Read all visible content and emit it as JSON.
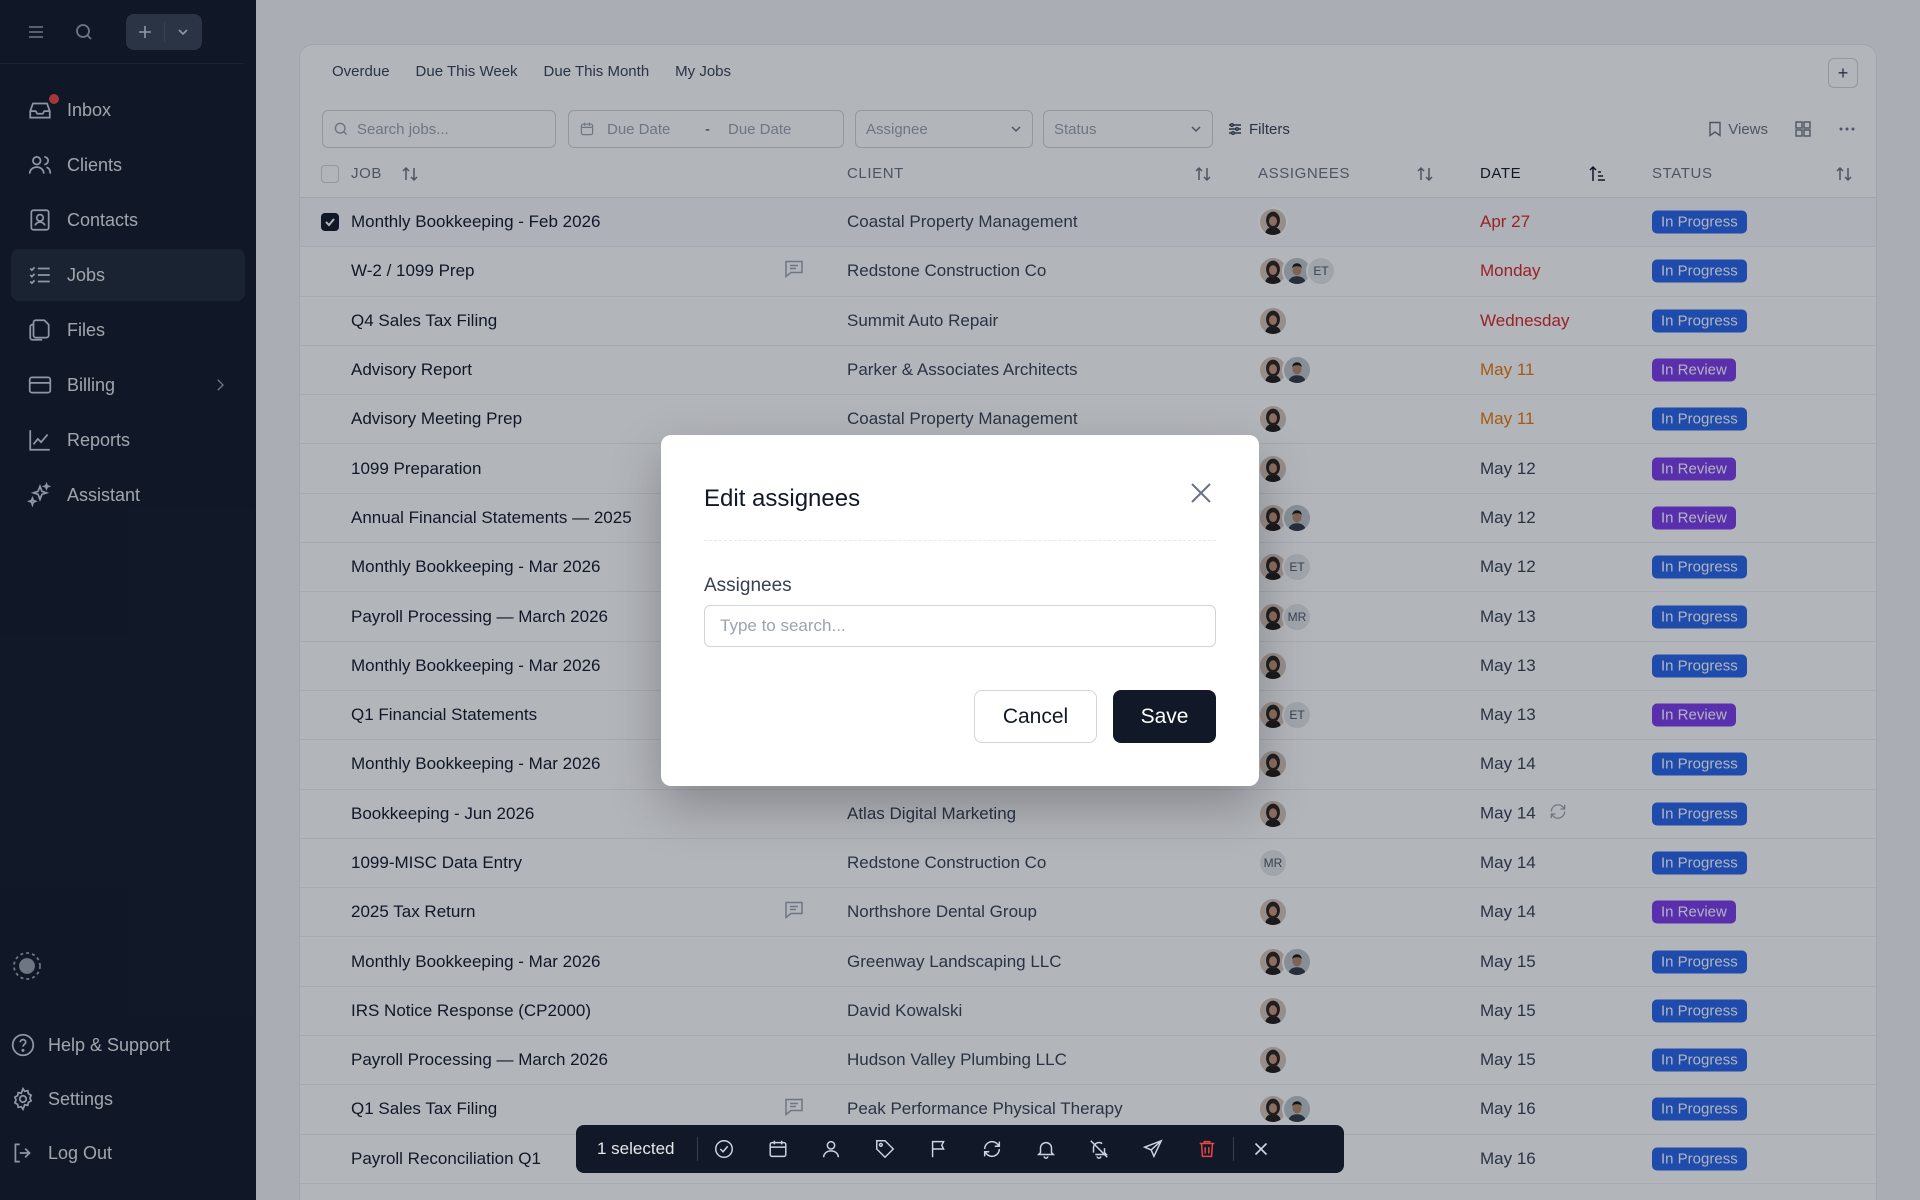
{
  "sidebar": {
    "items": [
      {
        "label": "Inbox",
        "icon": "inbox-icon",
        "badge_dot": true
      },
      {
        "label": "Clients",
        "icon": "users-icon"
      },
      {
        "label": "Contacts",
        "icon": "contacts-icon"
      },
      {
        "label": "Jobs",
        "icon": "jobs-list-icon",
        "active": true
      },
      {
        "label": "Files",
        "icon": "files-icon"
      },
      {
        "label": "Billing",
        "icon": "credit-card-icon",
        "has_submenu": true
      },
      {
        "label": "Reports",
        "icon": "chart-line-icon"
      },
      {
        "label": "Assistant",
        "icon": "sparkles-icon"
      }
    ],
    "bottom": [
      {
        "label": "Help & Support",
        "icon": "help-circle-icon"
      },
      {
        "label": "Settings",
        "icon": "gear-icon"
      },
      {
        "label": "Log Out",
        "icon": "log-out-icon"
      }
    ]
  },
  "tabs": [
    "Overdue",
    "Due This Week",
    "Due This Month",
    "My Jobs"
  ],
  "filters": {
    "search_placeholder": "Search jobs...",
    "due_date_from": "Due Date",
    "due_date_sep": "-",
    "due_date_to": "Due Date",
    "assignee": "Assignee",
    "status": "Status",
    "filters_label": "Filters",
    "views_label": "Views"
  },
  "table": {
    "headers": {
      "job": "JOB",
      "client": "CLIENT",
      "assignees": "ASSIGNEES",
      "date": "DATE",
      "status": "STATUS"
    },
    "rows": [
      {
        "job": "Monthly Bookkeeping - Feb 2026",
        "client": "Coastal Property Management",
        "assignees": [
          "photo-woman"
        ],
        "date": "Apr 27",
        "date_color": "red",
        "status": "In Progress",
        "selected": true
      },
      {
        "job": "W-2 / 1099 Prep",
        "comment": true,
        "client": "Redstone Construction Co",
        "assignees": [
          "photo-woman",
          "photo-man",
          "ET"
        ],
        "date": "Monday",
        "date_color": "red",
        "status": "In Progress"
      },
      {
        "job": "Q4 Sales Tax Filing",
        "client": "Summit Auto Repair",
        "assignees": [
          "photo-woman"
        ],
        "date": "Wednesday",
        "date_color": "red",
        "status": "In Progress"
      },
      {
        "job": "Advisory Report",
        "client": "Parker & Associates Architects",
        "assignees": [
          "photo-woman",
          "photo-man"
        ],
        "date": "May 11",
        "date_color": "orange",
        "status": "In Review"
      },
      {
        "job": "Advisory Meeting Prep",
        "client": "Coastal Property Management",
        "assignees": [
          "photo-woman"
        ],
        "date": "May 11",
        "date_color": "orange",
        "status": "In Progress"
      },
      {
        "job": "1099 Preparation",
        "client": "",
        "assignees": [
          "photo-woman"
        ],
        "date": "May 12",
        "status": "In Review"
      },
      {
        "job": "Annual Financial Statements — 2025",
        "client": "",
        "assignees": [
          "photo-woman",
          "photo-man"
        ],
        "date": "May 12",
        "status": "In Review"
      },
      {
        "job": "Monthly Bookkeeping - Mar 2026",
        "client": "",
        "assignees": [
          "photo-woman",
          "ET"
        ],
        "date": "May 12",
        "status": "In Progress"
      },
      {
        "job": "Payroll Processing — March 2026",
        "client": "",
        "assignees": [
          "photo-woman",
          "MR"
        ],
        "date": "May 13",
        "status": "In Progress"
      },
      {
        "job": "Monthly Bookkeeping - Mar 2026",
        "client": "",
        "assignees": [
          "photo-woman"
        ],
        "date": "May 13",
        "status": "In Progress"
      },
      {
        "job": "Q1 Financial Statements",
        "client": "",
        "assignees": [
          "photo-woman",
          "ET"
        ],
        "date": "May 13",
        "status": "In Review"
      },
      {
        "job": "Monthly Bookkeeping - Mar 2026",
        "client": "",
        "assignees": [
          "photo-woman"
        ],
        "date": "May 14",
        "status": "In Progress"
      },
      {
        "job": "Bookkeeping - Jun 2026",
        "client": "Atlas Digital Marketing",
        "assignees": [
          "photo-woman"
        ],
        "date": "May 14",
        "recurring": true,
        "status": "In Progress"
      },
      {
        "job": "1099-MISC Data Entry",
        "client": "Redstone Construction Co",
        "assignees": [
          "MR"
        ],
        "date": "May 14",
        "status": "In Progress"
      },
      {
        "job": "2025 Tax Return",
        "comment": true,
        "client": "Northshore Dental Group",
        "assignees": [
          "photo-woman"
        ],
        "date": "May 14",
        "status": "In Review"
      },
      {
        "job": "Monthly Bookkeeping - Mar 2026",
        "client": "Greenway Landscaping LLC",
        "assignees": [
          "photo-woman",
          "photo-man"
        ],
        "date": "May 15",
        "status": "In Progress"
      },
      {
        "job": "IRS Notice Response (CP2000)",
        "client": "David Kowalski",
        "assignees": [
          "photo-woman"
        ],
        "date": "May 15",
        "status": "In Progress"
      },
      {
        "job": "Payroll Processing — March 2026",
        "client": "Hudson Valley Plumbing LLC",
        "assignees": [
          "photo-woman"
        ],
        "date": "May 15",
        "status": "In Progress"
      },
      {
        "job": "Q1 Sales Tax Filing",
        "comment": true,
        "client": "Peak Performance Physical Therapy",
        "assignees": [
          "photo-woman",
          "photo-man"
        ],
        "date": "May 16",
        "status": "In Progress"
      },
      {
        "job": "Payroll Reconciliation Q1",
        "client": "",
        "assignees": [
          "photo-woman"
        ],
        "date": "May 16",
        "status": "In Progress"
      }
    ]
  },
  "modal": {
    "title": "Edit assignees",
    "field_label": "Assignees",
    "placeholder": "Type to search...",
    "cancel": "Cancel",
    "save": "Save"
  },
  "actionbar": {
    "selected": "1 selected",
    "actions": [
      "check-circle-icon",
      "calendar-icon",
      "user-icon",
      "tag-icon",
      "flag-icon",
      "refresh-icon",
      "bell-icon",
      "bell-off-icon",
      "send-icon",
      "trash-icon",
      "close-icon"
    ]
  },
  "colors": {
    "sidebar_bg": "#111827",
    "in_progress": "#2563eb",
    "in_review": "#7c3aed",
    "overdue_date": "#dc2626",
    "soon_date": "#ea7a0a",
    "dot_red": "#ef4444"
  }
}
